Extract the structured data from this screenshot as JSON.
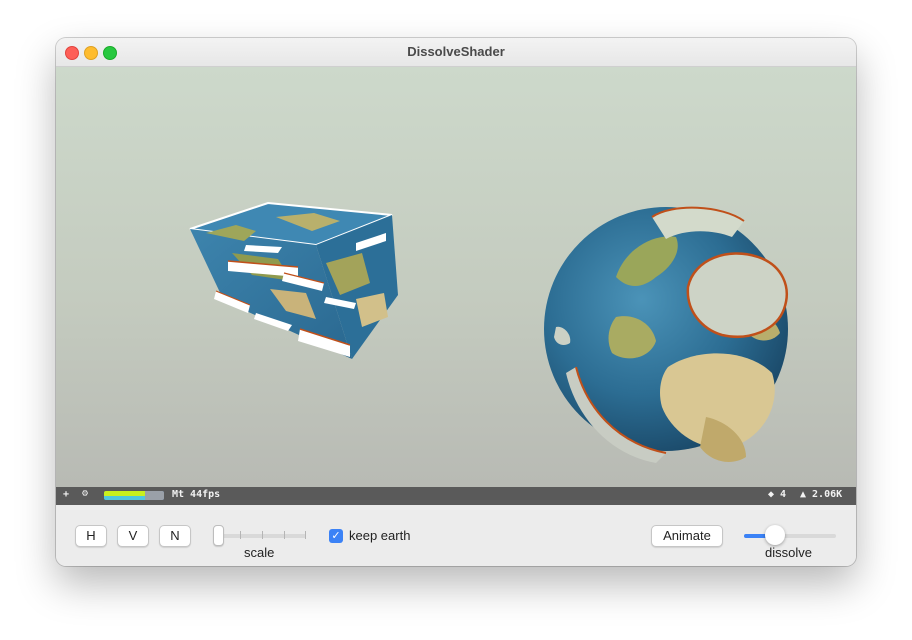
{
  "window": {
    "title": "DissolveShader"
  },
  "scene": {
    "objects": [
      "earth-box",
      "earth-globe"
    ]
  },
  "stats": {
    "plus": "+",
    "gear": "⚙",
    "fps_text": "Mt 44fps",
    "nodes_text": "◆ 4",
    "triangles_text": "▲ 2.06K",
    "perf_fraction": 0.68
  },
  "controls": {
    "h_label": "H",
    "v_label": "V",
    "n_label": "N",
    "scale_label": "scale",
    "scale_value": 0,
    "keep_earth_label": "keep earth",
    "keep_earth_checked": true,
    "animate_label": "Animate",
    "dissolve_label": "dissolve",
    "dissolve_value": 0.35,
    "accent_color": "#3b82f6"
  }
}
